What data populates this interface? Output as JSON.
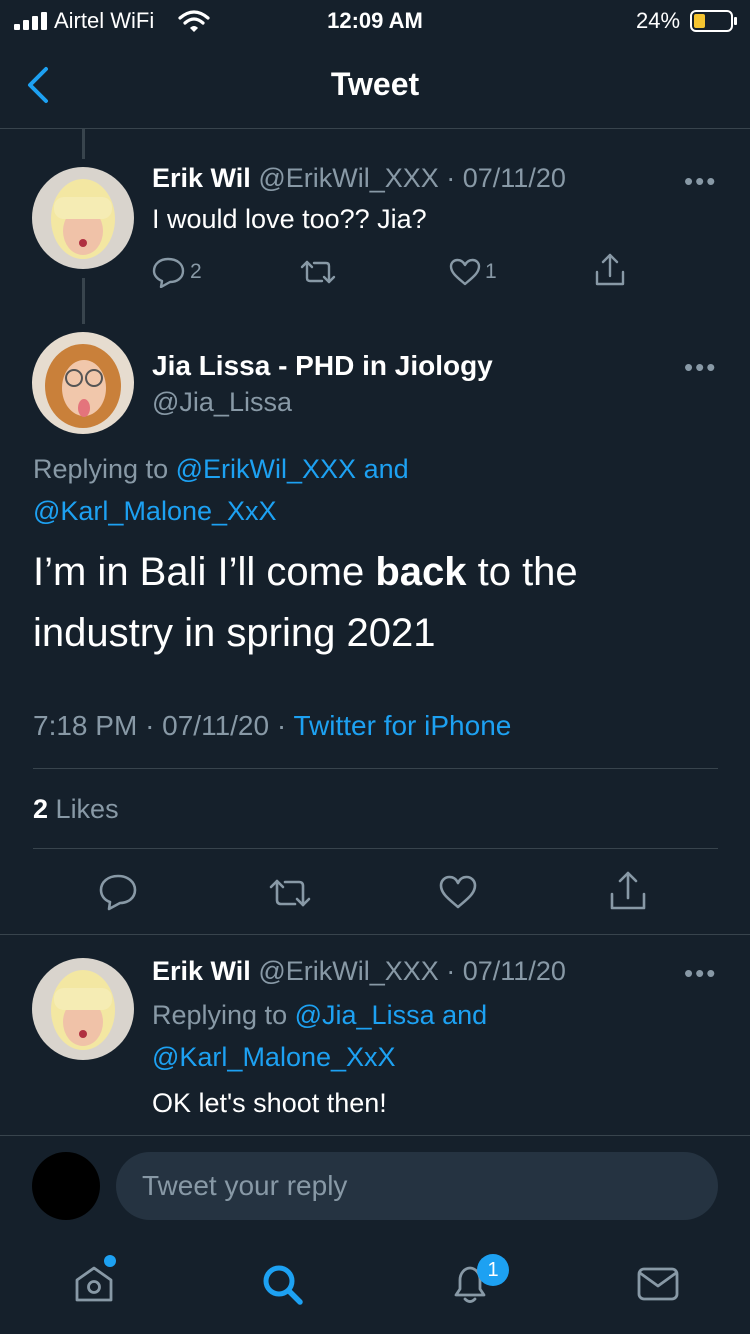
{
  "status_bar": {
    "carrier": "Airtel WiFi",
    "time": "12:09 AM",
    "battery": "24%"
  },
  "nav": {
    "title": "Tweet"
  },
  "parent_tweet": {
    "name": "Erik Wil",
    "handle": "@ErikWil_XXX",
    "date": "· 07/11/20",
    "text": "I would love too?? Jia?",
    "replies": "2",
    "likes": "1"
  },
  "main_tweet": {
    "name": "Jia Lissa - PHD in Jiology",
    "handle": "@Jia_Lissa",
    "replying_prefix": "Replying to",
    "replying_user1": "@ErikWil_XXX",
    "replying_and": "and",
    "replying_user2": "@Karl_Malone_XxX",
    "text_part1": "I’m in Bali I’ll come ",
    "text_bold": "back",
    "text_part2": " to the industry in spring 2021",
    "time": "7:18 PM",
    "date": "· 07/11/20 ·",
    "source": "Twitter for iPhone",
    "likes_count": "2",
    "likes_label": "Likes"
  },
  "reply_tweet": {
    "name": "Erik Wil",
    "handle": "@ErikWil_XXX",
    "date": "· 07/11/20",
    "replying_prefix": "Replying to",
    "replying_user1": "@Jia_Lissa",
    "replying_and": "and",
    "replying_user2": "@Karl_Malone_XxX",
    "text": "OK let's shoot then!"
  },
  "compose": {
    "placeholder": "Tweet your reply"
  },
  "tab_bar": {
    "notifications_badge": "1"
  },
  "colors": {
    "background": "#15202b",
    "accent": "#1da1f2",
    "muted": "#8899a6",
    "divider": "#38444d"
  }
}
